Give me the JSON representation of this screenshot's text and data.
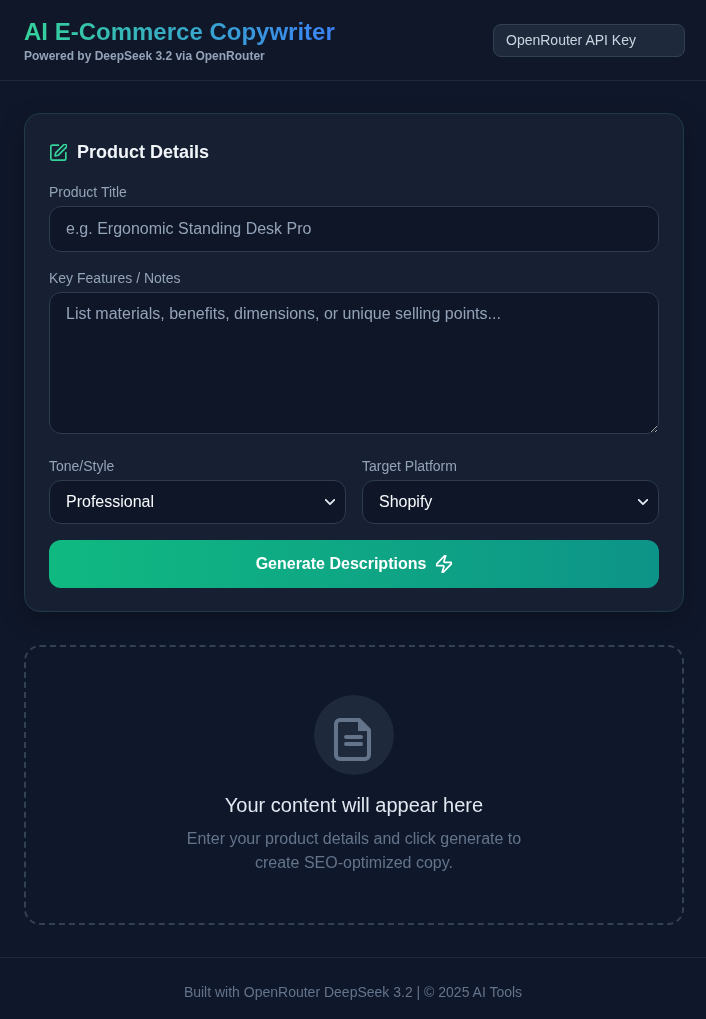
{
  "header": {
    "title": "AI E-Commerce Copywriter",
    "subtitle": "Powered by DeepSeek 3.2 via OpenRouter",
    "api_key": {
      "placeholder": "OpenRouter API Key"
    }
  },
  "form": {
    "heading": "Product Details",
    "fields": [
      {
        "kind": "input",
        "label": "Product Title",
        "placeholder": "e.g. Ergonomic Standing Desk Pro"
      },
      {
        "kind": "textarea",
        "label": "Key Features / Notes",
        "placeholder": "List materials, benefits, dimensions, or unique selling points..."
      }
    ],
    "selects": [
      {
        "label": "Tone/Style",
        "value": "Professional"
      },
      {
        "label": "Target Platform",
        "value": "Shopify"
      }
    ],
    "button": "Generate Descriptions"
  },
  "output": {
    "heading": "Your content will appear here",
    "message": "Enter your product details and click generate to create SEO-optimized copy."
  },
  "footer": "Built with OpenRouter DeepSeek 3.2 | © 2025 AI Tools"
}
